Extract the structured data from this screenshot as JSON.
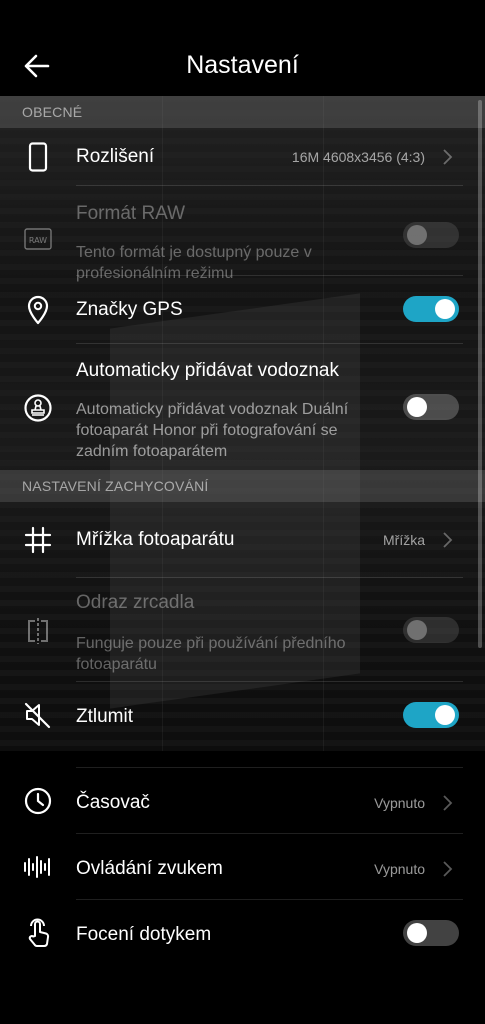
{
  "header": {
    "title": "Nastavení"
  },
  "sections": {
    "general": "OBECNÉ",
    "capture": "NASTAVENÍ ZACHYCOVÁNÍ"
  },
  "items": {
    "resolution": {
      "title": "Rozlišení",
      "value": "16M 4608x3456 (4:3)"
    },
    "raw": {
      "title": "Formát RAW",
      "desc": "Tento formát je dostupný pouze v profesionálním režimu",
      "toggle": "off",
      "enabled": false,
      "icon_text": "RAW"
    },
    "gps": {
      "title": "Značky GPS",
      "toggle": "on"
    },
    "watermark": {
      "title": "Automaticky přidávat vodoznak",
      "desc": "Automaticky přidávat vodoznak Duální fotoaparát Honor při fotografování se zadním fotoaparátem",
      "toggle": "off"
    },
    "grid": {
      "title": "Mřížka fotoaparátu",
      "value": "Mřížka"
    },
    "mirror": {
      "title": "Odraz zrcadla",
      "desc": "Funguje pouze při používání předního fotoaparátu",
      "toggle": "off",
      "enabled": false
    },
    "mute": {
      "title": "Ztlumit",
      "toggle": "on"
    },
    "timer": {
      "title": "Časovač",
      "value": "Vypnuto"
    },
    "voice": {
      "title": "Ovládání zvukem",
      "value": "Vypnuto"
    },
    "touch": {
      "title": "Focení dotykem",
      "toggle": "off"
    }
  },
  "colors": {
    "accent": "#1ea5c6",
    "background": "#000000"
  },
  "icons": [
    "back-arrow-icon",
    "phone-icon",
    "raw-icon",
    "location-pin-icon",
    "stamp-icon",
    "grid-icon",
    "mirror-icon",
    "mute-icon",
    "timer-icon",
    "voice-wave-icon",
    "touch-icon",
    "chevron-right-icon"
  ]
}
